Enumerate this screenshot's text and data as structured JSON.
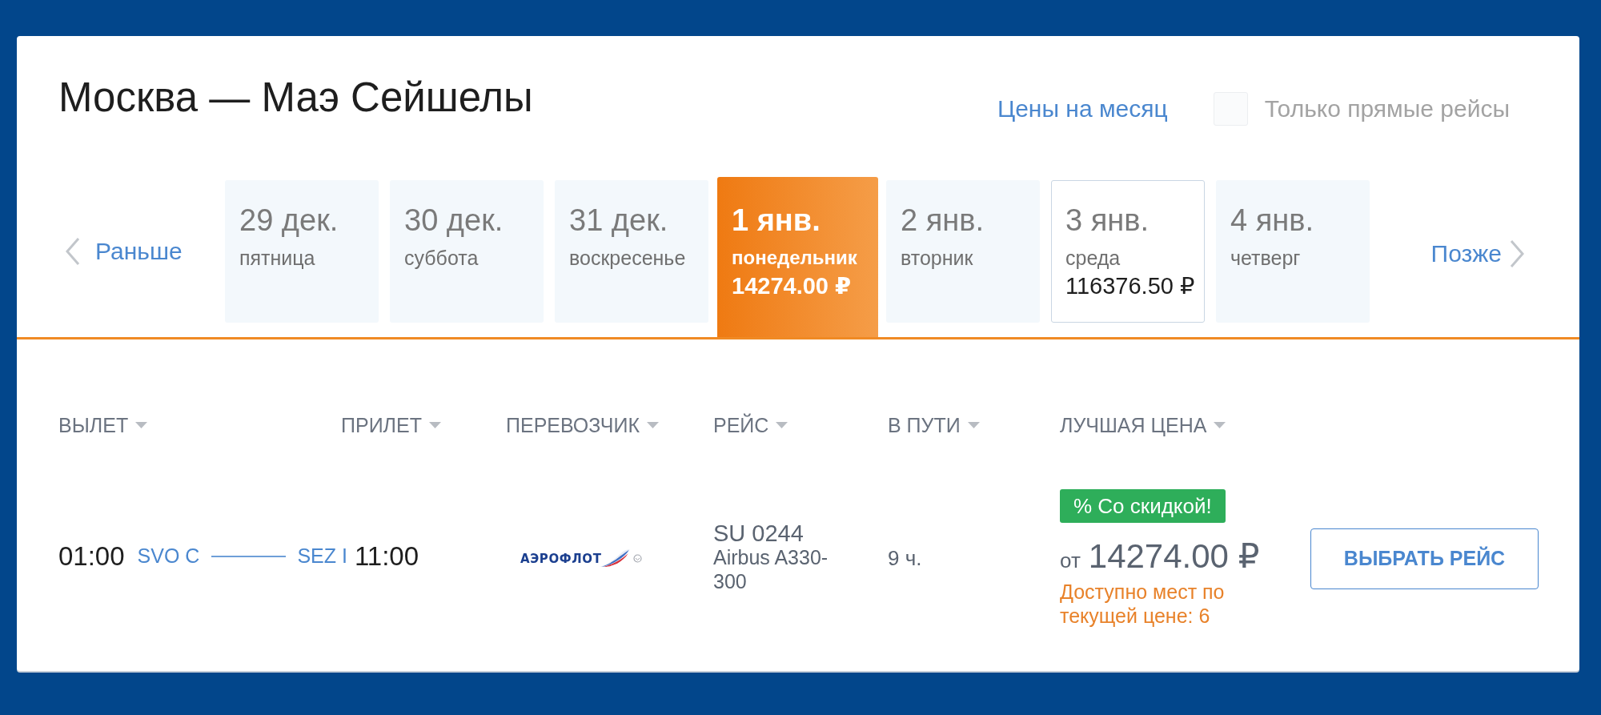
{
  "route_title": "Москва — Маэ Сейшелы",
  "month_prices_link": "Цены на месяц",
  "direct_only": {
    "label": "Только прямые рейсы",
    "checked": false
  },
  "date_nav": {
    "earlier": "Раньше",
    "later": "Позже"
  },
  "dates": [
    {
      "date": "29 дек.",
      "weekday": "пятница",
      "selected": false
    },
    {
      "date": "30 дек.",
      "weekday": "суббота",
      "selected": false
    },
    {
      "date": "31 дек.",
      "weekday": "воскресенье",
      "selected": false
    },
    {
      "date": "1 янв.",
      "weekday": "понедельник",
      "price": "14274.00 ₽",
      "selected": true
    },
    {
      "date": "2 янв.",
      "weekday": "вторник",
      "selected": false
    },
    {
      "date": "3 янв.",
      "weekday": "среда",
      "price": "116376.50 ₽",
      "selected": false
    },
    {
      "date": "4 янв.",
      "weekday": "четверг",
      "selected": false
    }
  ],
  "columns": [
    "ВЫЛЕТ",
    "ПРИЛЕТ",
    "ПЕРЕВОЗЧИК",
    "РЕЙС",
    "В ПУТИ",
    "ЛУЧШАЯ ЦЕНА"
  ],
  "flights": [
    {
      "departure_time": "01:00",
      "origin": "SVO C",
      "destination": "SEZ I",
      "arrival_time": "11:00",
      "carrier_logo_text": "АЭРОФЛОТ",
      "flight_number": "SU 0244",
      "aircraft": "Airbus A330-300",
      "duration": "9 ч.",
      "badge": "% Со скидкой!",
      "price_prefix": "от",
      "price": "14274.00 ₽",
      "seats_note": "Доступно мест по текущей цене: 6",
      "select_button": "ВЫБРАТЬ РЕЙС"
    }
  ]
}
